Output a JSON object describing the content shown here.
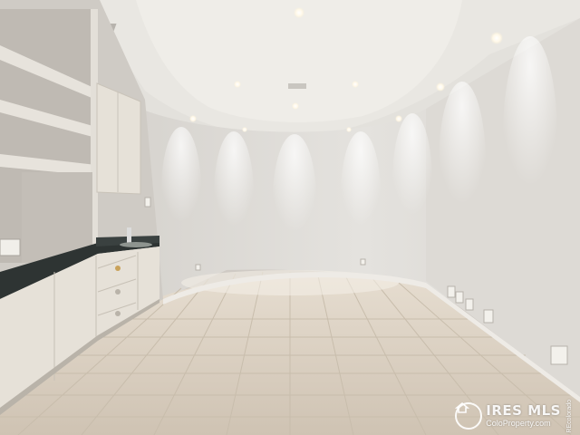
{
  "scene": {
    "description_colors": {
      "wall": "#dedcd8",
      "ceiling": "#e8e6e1",
      "floor": "#d8cdbd",
      "cabinet": "#e6e1d8",
      "countertop": "#2e3433"
    }
  },
  "watermark": {
    "brand": "IRES MLS",
    "site": "ColoProperty.com",
    "side_text": "REcolorado"
  }
}
